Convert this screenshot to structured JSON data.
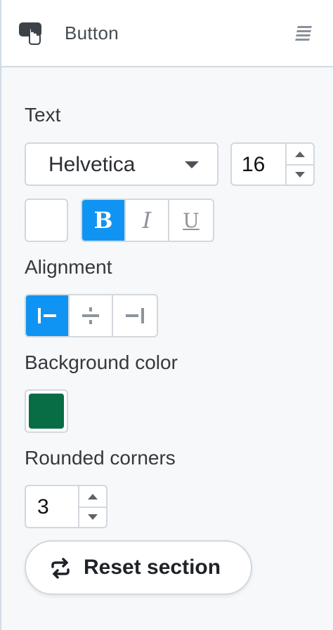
{
  "header": {
    "title": "Button",
    "icon": "button-pointer-icon",
    "handle_icon": "drag-handle-icon"
  },
  "text_section": {
    "label": "Text",
    "font_family": "Helvetica",
    "font_size": "16",
    "text_color": "#ffffff",
    "format": {
      "bold": {
        "label": "B",
        "active": true
      },
      "italic": {
        "label": "I",
        "active": false
      },
      "underline": {
        "label": "U",
        "active": false
      }
    }
  },
  "alignment_section": {
    "label": "Alignment",
    "options": [
      "align-left",
      "align-center",
      "align-right"
    ],
    "selected": "align-left"
  },
  "background_section": {
    "label": "Background color",
    "color": "#086c45"
  },
  "corners_section": {
    "label": "Rounded corners",
    "value": "3"
  },
  "reset_button": {
    "label": "Reset section",
    "icon": "repeat-icon"
  },
  "colors": {
    "accent": "#0f94f3"
  }
}
